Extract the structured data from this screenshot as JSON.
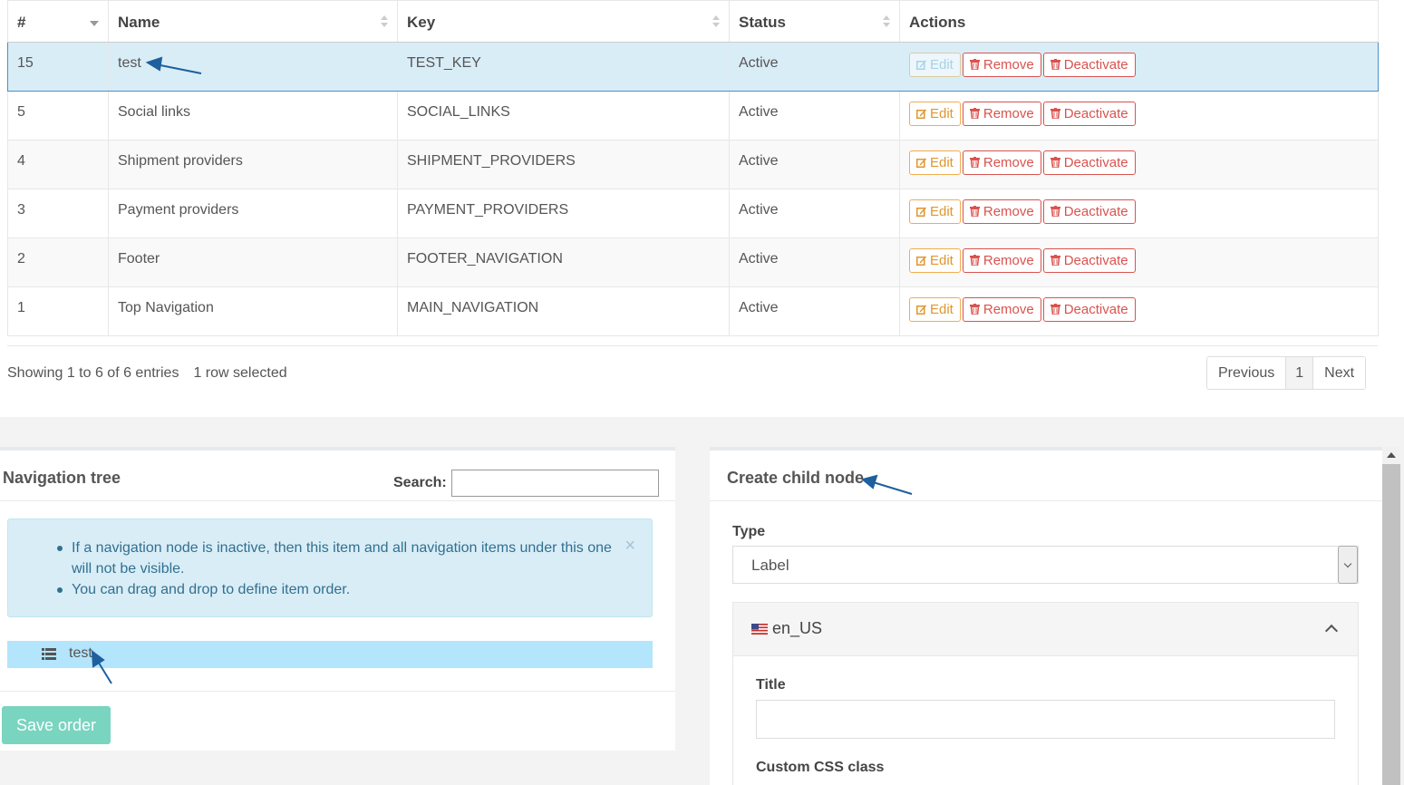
{
  "table": {
    "columns": [
      "#",
      "Name",
      "Key",
      "Status",
      "Actions"
    ],
    "rows": [
      {
        "id": "15",
        "name": "test",
        "key": "TEST_KEY",
        "status": "Active",
        "selected": true
      },
      {
        "id": "5",
        "name": "Social links",
        "key": "SOCIAL_LINKS",
        "status": "Active"
      },
      {
        "id": "4",
        "name": "Shipment providers",
        "key": "SHIPMENT_PROVIDERS",
        "status": "Active"
      },
      {
        "id": "3",
        "name": "Payment providers",
        "key": "PAYMENT_PROVIDERS",
        "status": "Active"
      },
      {
        "id": "2",
        "name": "Footer",
        "key": "FOOTER_NAVIGATION",
        "status": "Active"
      },
      {
        "id": "1",
        "name": "Top Navigation",
        "key": "MAIN_NAVIGATION",
        "status": "Active"
      }
    ],
    "actions": {
      "edit": "Edit",
      "remove": "Remove",
      "deactivate": "Deactivate"
    },
    "info": "Showing 1 to 6 of 6 entries",
    "selected_info": "1 row selected",
    "pager": {
      "prev": "Previous",
      "page": "1",
      "next": "Next"
    }
  },
  "nav_tree": {
    "title": "Navigation tree",
    "search_label": "Search:",
    "alert_items": [
      "If a navigation node is inactive, then this item and all navigation items under this one will not be visible.",
      "You can drag and drop to define item order."
    ],
    "close": "×",
    "items": [
      {
        "label": "test"
      }
    ],
    "save_label": "Save order"
  },
  "child_form": {
    "title": "Create child node",
    "type_label": "Type",
    "type_value": "Label",
    "locale": "en_US",
    "title_label": "Title",
    "css_label": "Custom CSS class"
  },
  "colors": {
    "accent": "#31708f",
    "selected_row": "#d9edf7",
    "save_button": "#79d4c0",
    "danger": "#d9534f",
    "warning": "#f0ad4e"
  }
}
